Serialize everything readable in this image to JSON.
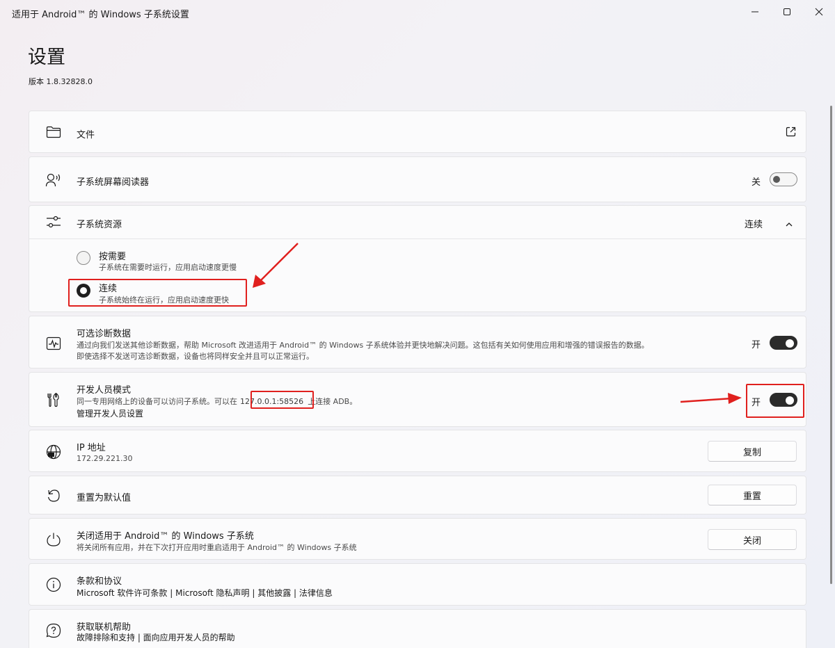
{
  "window": {
    "title": "适用于 Android™ 的 Windows 子系统设置"
  },
  "page": {
    "title": "设置",
    "version": "版本 1.8.32828.0"
  },
  "files": {
    "title": "文件",
    "icon": "folder-icon",
    "action_icon": "open-external-icon"
  },
  "screen_reader": {
    "title": "子系统屏幕阅读器",
    "state": "关",
    "icon": "screen-reader-icon"
  },
  "resources": {
    "title": "子系统资源",
    "selected": "连续",
    "icon": "sliders-icon",
    "options": [
      {
        "label": "按需要",
        "description": "子系统在需要时运行，应用启动速度更慢",
        "checked": false
      },
      {
        "label": "连续",
        "description": "子系统始终在运行，应用启动速度更快",
        "checked": true
      }
    ]
  },
  "diagnostics": {
    "title": "可选诊断数据",
    "line1": "通过向我们发送其他诊断数据，帮助 Microsoft 改进适用于 Android™ 的 Windows 子系统体验并更快地解决问题。这包括有关如何使用应用和增强的错误报告的数据。",
    "line2": "即使选择不发送可选诊断数据，设备也将同样安全并且可以正常运行。",
    "state": "开",
    "icon": "pulse-icon"
  },
  "developer": {
    "title": "开发人员模式",
    "desc_prefix": "同一专用网络上的设备可以访问子系统。可以在",
    "address": "127.0.0.1:58526",
    "desc_suffix": "上连接 ADB。",
    "link": "管理开发人员设置",
    "state": "开",
    "icon": "tools-icon"
  },
  "ip": {
    "title": "IP 地址",
    "value": "172.29.221.30",
    "button": "复制",
    "icon": "globe-icon"
  },
  "reset": {
    "title": "重置为默认值",
    "button": "重置",
    "icon": "reset-icon"
  },
  "shutdown": {
    "title": "关闭适用于 Android™ 的 Windows 子系统",
    "description": "将关闭所有应用，并在下次打开应用时重启适用于 Android™ 的 Windows 子系统",
    "button": "关闭",
    "icon": "power-icon"
  },
  "terms": {
    "title": "条款和协议",
    "links": "Microsoft 软件许可条款 | Microsoft 隐私声明 | 其他披露 | 法律信息",
    "icon": "info-icon"
  },
  "help": {
    "title": "获取联机帮助",
    "links": "故障排除和支持 | 面向应用开发人员的帮助",
    "icon": "help-icon"
  },
  "colors": {
    "annotation_red": "#e0201e",
    "toggle_on": "#2b2b2b"
  }
}
